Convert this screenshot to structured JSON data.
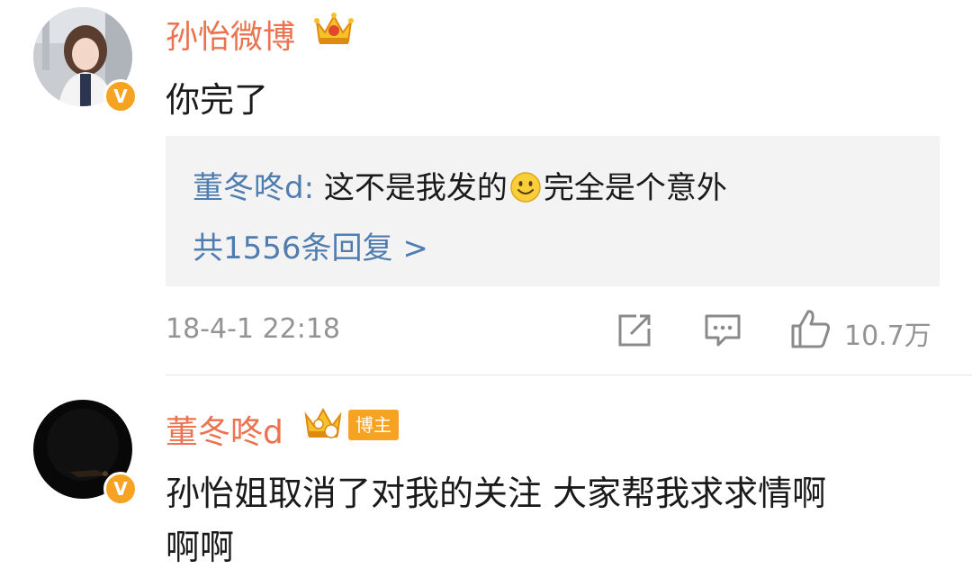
{
  "comments": [
    {
      "username": "孙怡微博",
      "text": "你完了",
      "verified_badge": "V",
      "reply": {
        "author": "董冬咚d",
        "separator": ": ",
        "text_before": "这不是我发的",
        "emoji": "smiley-emoji",
        "text_after": "完全是个意外",
        "count_label": "共1556条回复 >"
      },
      "time": "18-4-1 22:18",
      "likes": "10.7万"
    },
    {
      "username": "董冬咚d",
      "badge": "博主",
      "verified_badge": "V",
      "text_line1": "孙怡姐取消了对我的关注 大家帮我求求情啊",
      "text_line2": "啊啊"
    }
  ],
  "colors": {
    "username": "#eb7350",
    "link": "#507daf",
    "meta": "#939393",
    "badge": "#f6a324",
    "reply_bg": "#f3f3f3"
  }
}
